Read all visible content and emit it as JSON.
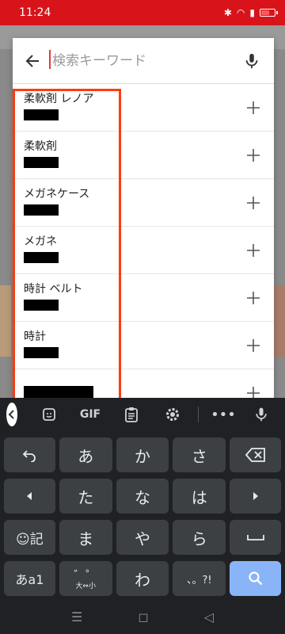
{
  "status": {
    "time": "11:24",
    "icons": [
      "bluetooth-icon",
      "wifi-icon",
      "mobile-data-icon",
      "signal-icon",
      "battery-icon"
    ]
  },
  "search": {
    "placeholder": "検索キーワード"
  },
  "suggestions": [
    {
      "label": "柔軟剤 レノア"
    },
    {
      "label": "柔軟剤"
    },
    {
      "label": "メガネケース"
    },
    {
      "label": "メガネ"
    },
    {
      "label": "時計 ベルト"
    },
    {
      "label": "時計"
    },
    {
      "label": ""
    }
  ],
  "keyboard": {
    "toolbar": {
      "gif": "GIF",
      "more": "•••"
    },
    "rows": [
      [
        "あ",
        "か",
        "さ"
      ],
      [
        "た",
        "な",
        "は"
      ],
      [
        "ま",
        "や",
        "ら"
      ],
      [
        "わ"
      ]
    ],
    "emoji_label": "☺記",
    "mode_label": "あa1",
    "dakuten_label": "゛゜",
    "dakuten_sub": "大⇔小",
    "punct_label": "、。?!",
    "enter_icon": "search-icon"
  },
  "colors": {
    "status_bar": "#d8141a",
    "highlight": "#ff3b10",
    "keyboard_bg": "#202124",
    "key": "#3c4043",
    "action_key": "#8ab4f8"
  }
}
